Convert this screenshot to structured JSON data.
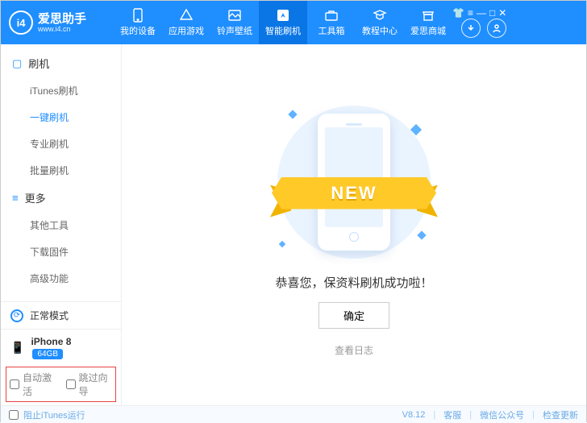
{
  "brand": {
    "name": "爱思助手",
    "site": "www.i4.cn",
    "logo_text": "i4"
  },
  "nav": {
    "items": [
      {
        "label": "我的设备"
      },
      {
        "label": "应用游戏"
      },
      {
        "label": "铃声壁纸"
      },
      {
        "label": "智能刷机"
      },
      {
        "label": "工具箱"
      },
      {
        "label": "教程中心"
      },
      {
        "label": "爱思商城"
      }
    ],
    "active_index": 3
  },
  "sidebar": {
    "groups": [
      {
        "title": "刷机",
        "items": [
          "iTunes刷机",
          "一键刷机",
          "专业刷机",
          "批量刷机"
        ],
        "active_index": 1
      },
      {
        "title": "更多",
        "items": [
          "其他工具",
          "下载固件",
          "高级功能"
        ],
        "active_index": -1
      }
    ],
    "mode_label": "正常模式",
    "device_name": "iPhone 8",
    "device_storage": "64GB",
    "auto_activate_label": "自动激活",
    "skip_guide_label": "跳过向导"
  },
  "main": {
    "ribbon_text": "NEW",
    "success_message": "恭喜您，保资料刷机成功啦！",
    "ok_label": "确定",
    "view_log_label": "查看日志"
  },
  "statusbar": {
    "block_itunes_label": "阻止iTunes运行",
    "version": "V8.12",
    "support": "客服",
    "wechat": "微信公众号",
    "check_update": "检查更新"
  }
}
